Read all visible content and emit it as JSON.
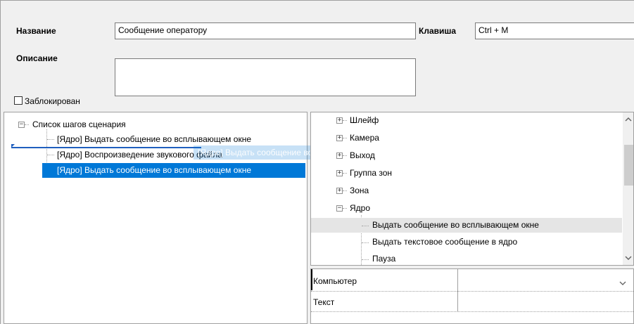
{
  "form": {
    "name_label": "Название",
    "name_value": "Сообщение оператору",
    "key_label": "Клавиша",
    "key_value": "Ctrl + M",
    "description_label": "Описание",
    "description_value": "",
    "locked_label": "Заблокирован",
    "locked_checked": false
  },
  "steps": {
    "root_label": "Список шагов сценария",
    "items": [
      "[Ядро] Выдать сообщение во всплывающем окне",
      "[Ядро] Воспроизведение звукового файла",
      "[Ядро] Выдать сообщение во всплывающем окне"
    ],
    "drag_ghost": "[Ядро] Выдать сообщение во всплывающем окне"
  },
  "actions_tree": {
    "nodes": [
      "Шлейф",
      "Камера",
      "Выход",
      "Группа зон",
      "Зона",
      "Ядро"
    ],
    "core_children": [
      "Выдать сообщение во всплывающем окне",
      "Выдать текстовое сообщение в ядро",
      "Пауза"
    ]
  },
  "properties": {
    "rows": [
      {
        "name": "Компьютер",
        "value": ""
      },
      {
        "name": "Текст",
        "value": ""
      }
    ]
  },
  "icons": {
    "expand": "plus-box-icon",
    "collapse": "minus-box-icon",
    "scroll_up": "chevron-up-icon",
    "scroll_down": "chevron-down-icon",
    "dropdown": "chevron-down-icon"
  },
  "colors": {
    "selection": "#0078d7",
    "hover": "#e5e5e5",
    "background": "#f0f0f0"
  }
}
